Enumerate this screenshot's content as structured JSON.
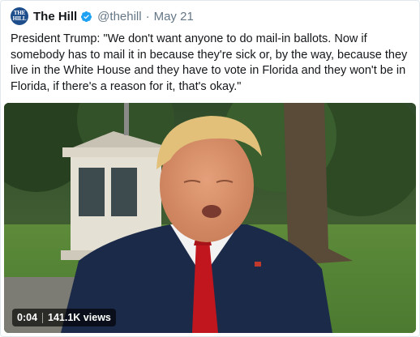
{
  "tweet": {
    "author_name": "The Hill",
    "author_handle": "@thehill",
    "separator": "·",
    "date": "May 21",
    "avatar_text": "THE HILL",
    "text": "President Trump: \"We don't want anyone to do mail-in ballots. Now if somebody has to mail it in because they're sick or, by the way, because they live in the White House and they have to vote in Florida and they won't be in Florida, if there's a reason for it, that's okay.\""
  },
  "video": {
    "elapsed": "0:04",
    "views": "141.1K views"
  },
  "colors": {
    "verified_badge": "#1da1f2",
    "avatar_bg": "#1f4e8c",
    "handle_gray": "#657786",
    "border": "#e1e8ed"
  },
  "icons": {
    "verified": "verified-badge-icon"
  }
}
